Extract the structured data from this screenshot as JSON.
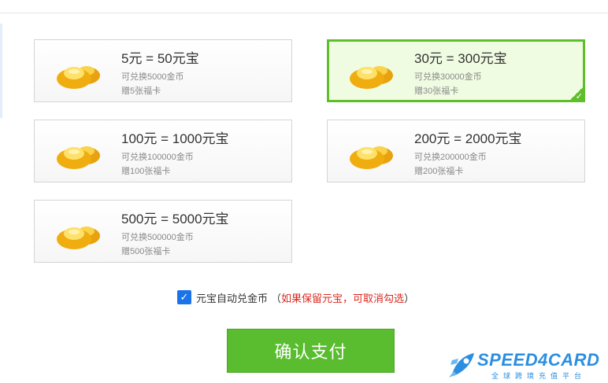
{
  "options": [
    {
      "title": "5元 = 50元宝",
      "line1": "可兑换5000金币",
      "line2": "赠5张福卡",
      "selected": false
    },
    {
      "title": "30元 = 300元宝",
      "line1": "可兑换30000金币",
      "line2": "赠30张福卡",
      "selected": true
    },
    {
      "title": "100元 = 1000元宝",
      "line1": "可兑换100000金币",
      "line2": "赠100张福卡",
      "selected": false
    },
    {
      "title": "200元 = 2000元宝",
      "line1": "可兑换200000金币",
      "line2": "赠200张福卡",
      "selected": false
    },
    {
      "title": "500元 = 5000元宝",
      "line1": "可兑换500000金币",
      "line2": "赠500张福卡",
      "selected": false
    }
  ],
  "auto_convert": {
    "checked": true,
    "check_mark": "✓",
    "label": "元宝自动兑金币",
    "note_open": "（",
    "note_red": "如果保留元宝，可取消勾选",
    "note_close": "）"
  },
  "confirm_button": "确认支付",
  "selected_mark": "✓",
  "watermark": {
    "name": "SPEED4CARD",
    "subtitle": "全球跨境充值平台"
  },
  "colors": {
    "accent_green": "#59bd2f",
    "selected_border": "#5fbf2b",
    "selected_bg": "#f0fce2",
    "checkbox_blue": "#1a73e8",
    "note_red": "#d9281f",
    "brand_blue": "#2b8ee0"
  },
  "icons": {
    "ingot": "gold-ingot-icon",
    "checkbox": "checkbox-checked-icon",
    "corner": "check-corner-icon",
    "brand": "rocket-logo-icon"
  }
}
